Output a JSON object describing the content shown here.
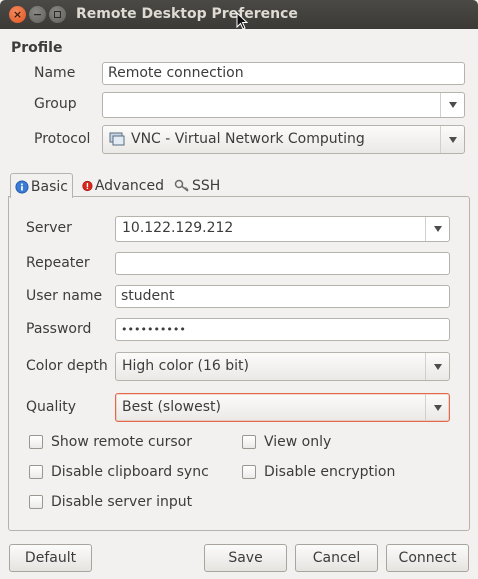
{
  "window": {
    "title": "Remote Desktop Preference"
  },
  "profile": {
    "section_title": "Profile",
    "name_label": "Name",
    "name_value": "Remote connection",
    "group_label": "Group",
    "group_value": "",
    "protocol_label": "Protocol",
    "protocol_value": "VNC - Virtual Network Computing"
  },
  "tabs": {
    "basic": "Basic",
    "advanced": "Advanced",
    "ssh": "SSH",
    "active": "Basic"
  },
  "basic": {
    "server_label": "Server",
    "server_value": "10.122.129.212",
    "repeater_label": "Repeater",
    "repeater_value": "",
    "username_label": "User name",
    "username_value": "student",
    "password_label": "Password",
    "password_value": "••••••••••",
    "colordepth_label": "Color depth",
    "colordepth_value": "High color (16 bit)",
    "quality_label": "Quality",
    "quality_value": "Best (slowest)",
    "checkboxes": {
      "show_remote_cursor": "Show remote cursor",
      "view_only": "View only",
      "disable_clipboard_sync": "Disable clipboard sync",
      "disable_encryption": "Disable encryption",
      "disable_server_input": "Disable server input"
    }
  },
  "buttons": {
    "default": "Default",
    "save": "Save",
    "cancel": "Cancel",
    "connect": "Connect"
  },
  "colors": {
    "titlebar": "#3c3b37",
    "close_button": "#e0531f",
    "window_bg": "#f2f1f0",
    "focus_border": "#e06a4a"
  }
}
